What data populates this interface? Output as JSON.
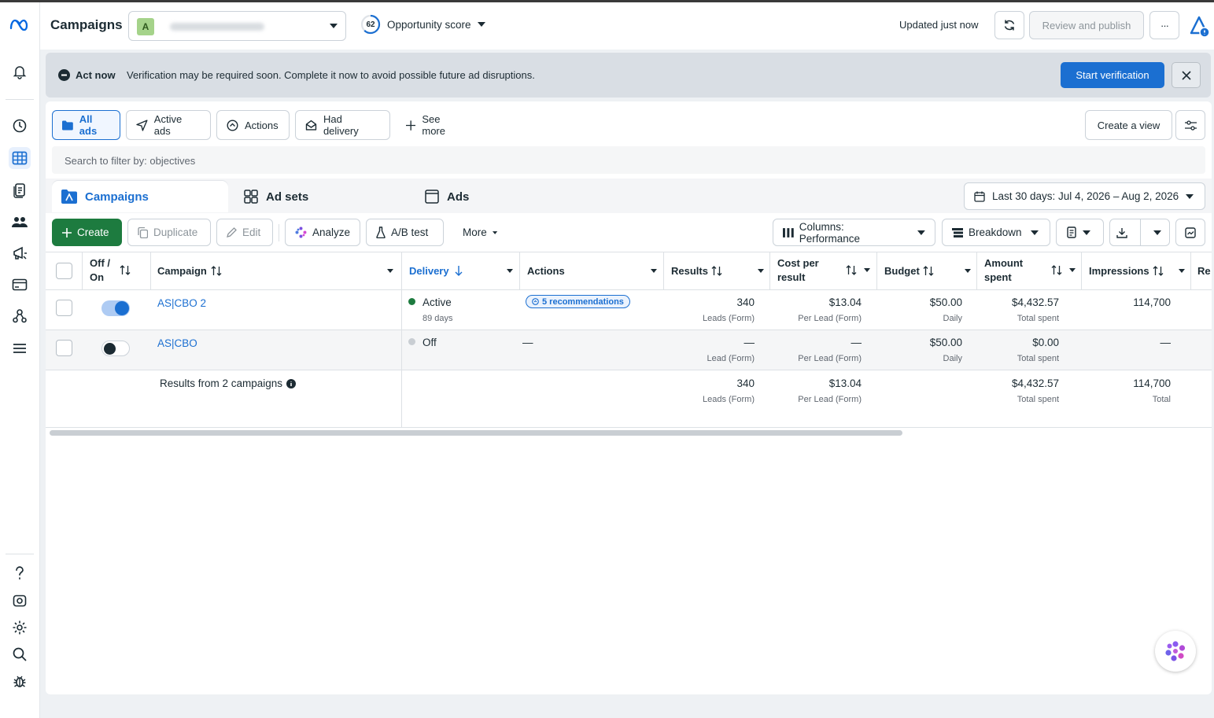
{
  "topbar": {
    "title": "Campaigns",
    "account_badge": "A",
    "opportunity_score_value": "62",
    "opportunity_score_label": "Opportunity score",
    "updated": "Updated just now",
    "review_publish": "Review and publish",
    "more": "···"
  },
  "banner": {
    "label": "Act now",
    "message": "Verification may be required soon. Complete it now to avoid possible future ad disruptions.",
    "button": "Start verification"
  },
  "filters": {
    "chips": [
      "All ads",
      "Active ads",
      "Actions",
      "Had delivery",
      "See more"
    ],
    "create_view": "Create a view",
    "search_placeholder": "Search to filter by: objectives"
  },
  "tabs": [
    "Campaigns",
    "Ad sets",
    "Ads"
  ],
  "date_range": "Last 30 days: Jul 4, 2026 – Aug 2, 2026",
  "toolbar": {
    "create": "Create",
    "duplicate": "Duplicate",
    "edit": "Edit",
    "analyze": "Analyze",
    "ab_test": "A/B test",
    "more": "More",
    "columns": "Columns: Performance",
    "breakdown": "Breakdown"
  },
  "table": {
    "headers": {
      "off_on_1": "Off /",
      "off_on_2": "On",
      "campaign": "Campaign",
      "delivery": "Delivery",
      "actions": "Actions",
      "results": "Results",
      "cost_1": "Cost per",
      "cost_2": "result",
      "budget": "Budget",
      "amount_1": "Amount",
      "amount_2": "spent",
      "impressions": "Impressions",
      "reach": "Re"
    },
    "rows": [
      {
        "on": true,
        "campaign": "AS|CBO 2",
        "delivery": "Active",
        "delivery_sub": "89 days",
        "actions": "5 recommendations",
        "results": "340",
        "results_sub": "Leads (Form)",
        "cost": "$13.04",
        "cost_sub": "Per Lead (Form)",
        "budget": "$50.00",
        "budget_sub": "Daily",
        "amount": "$4,432.57",
        "amount_sub": "Total spent",
        "impressions": "114,700"
      },
      {
        "on": false,
        "campaign": "AS|CBO",
        "delivery": "Off",
        "delivery_sub": "",
        "actions": "—",
        "results": "—",
        "results_sub": "Lead (Form)",
        "cost": "—",
        "cost_sub": "Per Lead (Form)",
        "budget": "$50.00",
        "budget_sub": "Daily",
        "amount": "$0.00",
        "amount_sub": "Total spent",
        "impressions": "—"
      }
    ],
    "summary": {
      "label": "Results from 2 campaigns",
      "results": "340",
      "results_sub": "Leads (Form)",
      "cost": "$13.04",
      "cost_sub": "Per Lead (Form)",
      "amount": "$4,432.57",
      "amount_sub": "Total spent",
      "impressions": "114,700",
      "impressions_sub": "Total"
    }
  },
  "colors": {
    "accent": "#1b6fd1",
    "create_green": "#1d7b3f",
    "active_green": "#1d7b3f",
    "off_grey": "#c9ced3"
  }
}
